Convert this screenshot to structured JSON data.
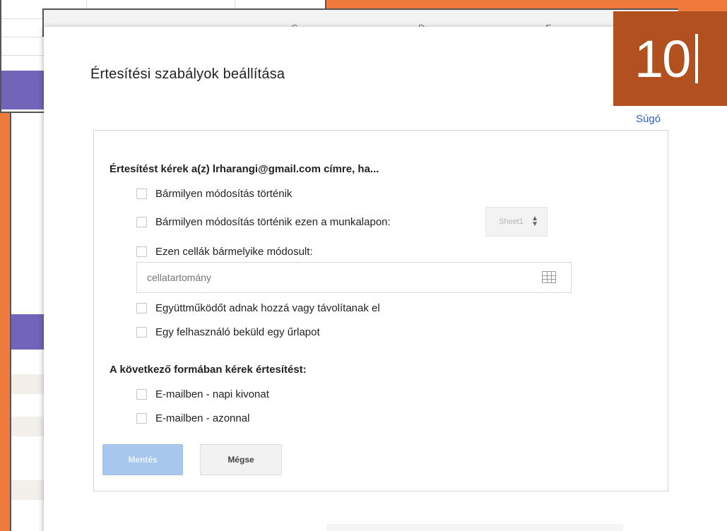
{
  "background": {
    "column_letters": [
      "C",
      "D",
      "E"
    ]
  },
  "page_number": "10",
  "dialog": {
    "title": "Értesítési szabályok beállítása",
    "help_link": "Súgó",
    "section1_title": "Értesítést kérek a(z) lrharangi@gmail.com címre, ha...",
    "options1": [
      {
        "label": "Bármilyen módosítás történik",
        "checked": false
      },
      {
        "label": "Bármilyen módosítás történik ezen a munkalapon:",
        "checked": false
      },
      {
        "label": "Ezen cellák bármelyike módosult:",
        "checked": false
      },
      {
        "label": "Együttműködőt adnak hozzá vagy távolítanak el",
        "checked": false
      },
      {
        "label": "Egy felhasználó beküld egy űrlapot",
        "checked": false
      }
    ],
    "sheet_select": {
      "value": "Sheet1"
    },
    "range_input": {
      "placeholder": "cellatartomány",
      "value": ""
    },
    "section2_title": "A következő formában kérek értesítést:",
    "options2": [
      {
        "label": "E-mailben - napi kivonat",
        "checked": false
      },
      {
        "label": "E-mailben - azonnal",
        "checked": false
      }
    ],
    "save_button": "Mentés",
    "cancel_button": "Mégse"
  },
  "colors": {
    "background_orange": "#f07a3c",
    "badge": "#b3501f",
    "link": "#2a62c9",
    "save_button": "#a8c7ec",
    "purple_rows": "#7264b8"
  },
  "icons": {
    "grid": "grid-icon",
    "select_arrows": "up-down-arrows-icon"
  }
}
